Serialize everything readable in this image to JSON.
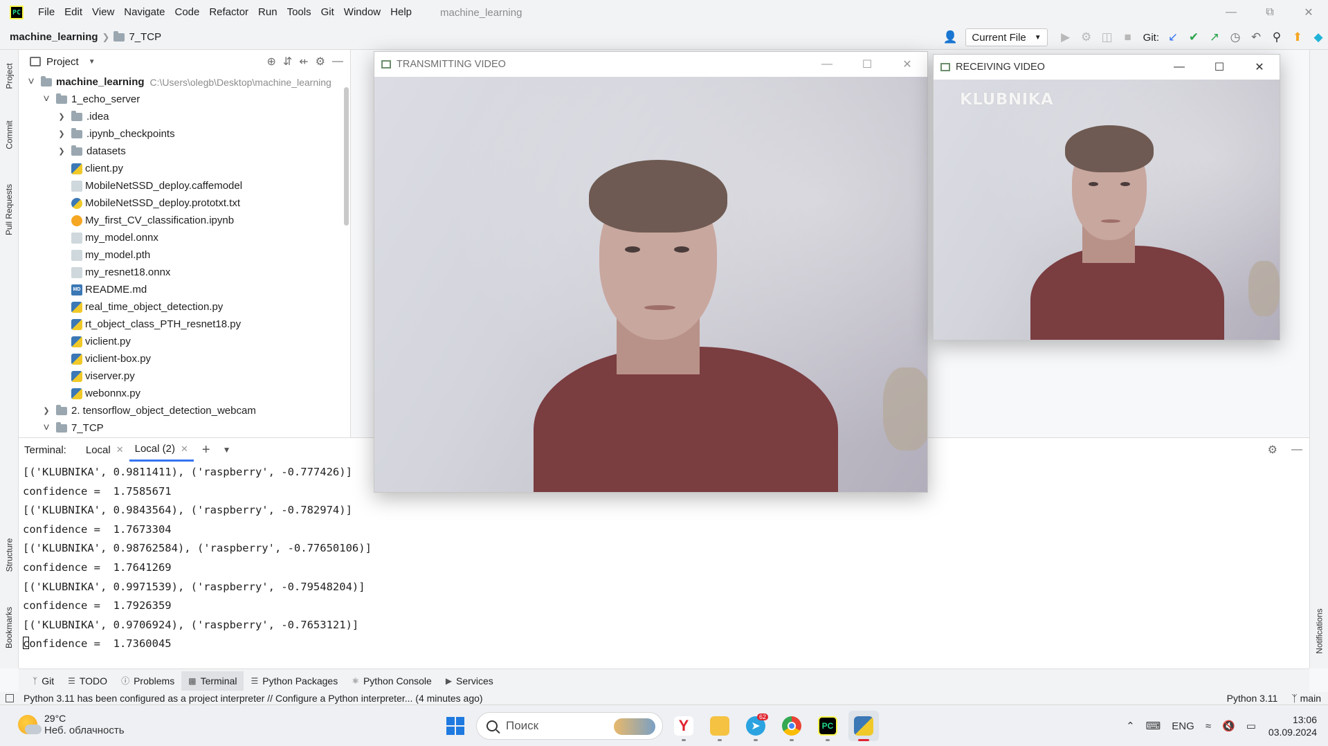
{
  "menubar": {
    "items": [
      "File",
      "Edit",
      "View",
      "Navigate",
      "Code",
      "Refactor",
      "Run",
      "Tools",
      "Git",
      "Window",
      "Help"
    ],
    "project_title": "machine_learning",
    "window_controls": [
      "minimize-icon",
      "restore-icon",
      "close-icon"
    ]
  },
  "navbar": {
    "root": "machine_learning",
    "child": "7_TCP",
    "run_config": "Current File",
    "git_label": "Git:"
  },
  "left_strip": {
    "tabs": [
      "Project",
      "Commit",
      "Pull Requests",
      "Structure",
      "Bookmarks"
    ]
  },
  "right_strip": {
    "tabs": [
      "Notifications"
    ]
  },
  "project_panel": {
    "title": "Project",
    "tree": [
      {
        "label": "machine_learning",
        "hint": "C:\\Users\\olegb\\Desktop\\machine_learning",
        "type": "folder",
        "depth": 0,
        "expanded": true,
        "bold": true
      },
      {
        "label": "1_echo_server",
        "type": "folder",
        "depth": 1,
        "expanded": true
      },
      {
        "label": ".idea",
        "type": "folder",
        "depth": 2,
        "expanded": false
      },
      {
        "label": ".ipynb_checkpoints",
        "type": "folder",
        "depth": 2,
        "expanded": false
      },
      {
        "label": "datasets",
        "type": "folder",
        "depth": 2,
        "expanded": false
      },
      {
        "label": "client.py",
        "type": "py",
        "depth": 2
      },
      {
        "label": "MobileNetSSD_deploy.caffemodel",
        "type": "generic",
        "depth": 2
      },
      {
        "label": "MobileNetSSD_deploy.prototxt.txt",
        "type": "txt",
        "depth": 2
      },
      {
        "label": "My_first_CV_classification.ipynb",
        "type": "ipynb",
        "depth": 2
      },
      {
        "label": "my_model.onnx",
        "type": "generic",
        "depth": 2
      },
      {
        "label": "my_model.pth",
        "type": "generic",
        "depth": 2
      },
      {
        "label": "my_resnet18.onnx",
        "type": "generic",
        "depth": 2
      },
      {
        "label": "README.md",
        "type": "md",
        "depth": 2
      },
      {
        "label": "real_time_object_detection.py",
        "type": "py",
        "depth": 2
      },
      {
        "label": "rt_object_class_PTH_resnet18.py",
        "type": "py",
        "depth": 2
      },
      {
        "label": "viclient.py",
        "type": "py",
        "depth": 2
      },
      {
        "label": "viclient-box.py",
        "type": "py",
        "depth": 2
      },
      {
        "label": "viserver.py",
        "type": "py",
        "depth": 2
      },
      {
        "label": "webonnx.py",
        "type": "py",
        "depth": 2
      },
      {
        "label": "2. tensorflow_object_detection_webcam",
        "type": "folder",
        "depth": 1,
        "expanded": false
      },
      {
        "label": "7_TCP",
        "type": "folder",
        "depth": 1,
        "expanded": true
      }
    ]
  },
  "terminal": {
    "label": "Terminal:",
    "tabs": [
      {
        "label": "Local",
        "active": false
      },
      {
        "label": "Local (2)",
        "active": true
      }
    ],
    "lines": [
      "[('KLUBNIKA', 0.9811411), ('raspberry', -0.777426)]",
      "confidence =  1.7585671",
      "[('KLUBNIKA', 0.9843564), ('raspberry', -0.782974)]",
      "confidence =  1.7673304",
      "[('KLUBNIKA', 0.98762584), ('raspberry', -0.77650106)]",
      "confidence =  1.7641269",
      "[('KLUBNIKA', 0.9971539), ('raspberry', -0.79548204)]",
      "confidence =  1.7926359",
      "[('KLUBNIKA', 0.9706924), ('raspberry', -0.7653121)]",
      "confidence =  1.7360045"
    ]
  },
  "tool_tabs": [
    {
      "label": "Git",
      "icon": "git-branch-icon"
    },
    {
      "label": "TODO",
      "icon": "list-icon"
    },
    {
      "label": "Problems",
      "icon": "warning-icon"
    },
    {
      "label": "Terminal",
      "icon": "terminal-icon",
      "active": true
    },
    {
      "label": "Python Packages",
      "icon": "layers-icon"
    },
    {
      "label": "Python Console",
      "icon": "python-icon"
    },
    {
      "label": "Services",
      "icon": "play-circle-icon"
    }
  ],
  "status_bar": {
    "message": "Python 3.11 has been configured as a project interpreter // Configure a Python interpreter... (4 minutes ago)",
    "interpreter": "Python 3.11",
    "branch": "main"
  },
  "windows": {
    "transmitting": {
      "title": "TRANSMITTING VIDEO"
    },
    "receiving": {
      "title": "RECEIVING VIDEO",
      "overlay": "KLUBNIKA"
    }
  },
  "taskbar": {
    "weather_temp": "29°C",
    "weather_desc": "Неб. облачность",
    "search_placeholder": "Поиск",
    "telegram_badge": "62",
    "lang": "ENG",
    "time": "13:06",
    "date": "03.09.2024",
    "apps": [
      "yandex-browser-icon",
      "file-explorer-icon",
      "telegram-icon",
      "chrome-icon",
      "pycharm-icon",
      "python-app-icon"
    ]
  },
  "colors": {
    "accent": "#3574f0",
    "pycharm_green": "#21d789",
    "terminal_text": "#1f1f1f"
  }
}
